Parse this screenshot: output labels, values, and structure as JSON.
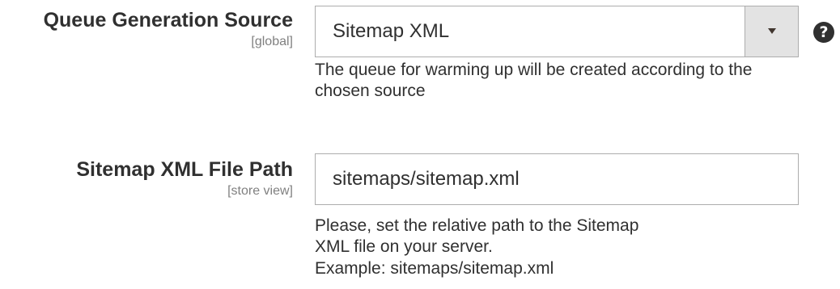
{
  "queue_source": {
    "label": "Queue Generation Source",
    "scope": "[global]",
    "selected_value": "Sitemap XML",
    "help_glyph": "?",
    "note": "The queue for warming up will be created according to the chosen source"
  },
  "sitemap_path": {
    "label": "Sitemap XML File Path",
    "scope": "[store view]",
    "value": "sitemaps/sitemap.xml",
    "note_line1": "Please, set the relative path to the Sitemap XML file on your server.",
    "note_line2": "Example: sitemaps/sitemap.xml"
  },
  "icons": {
    "select_arrow": "chevron-down-icon",
    "help": "help-icon"
  }
}
